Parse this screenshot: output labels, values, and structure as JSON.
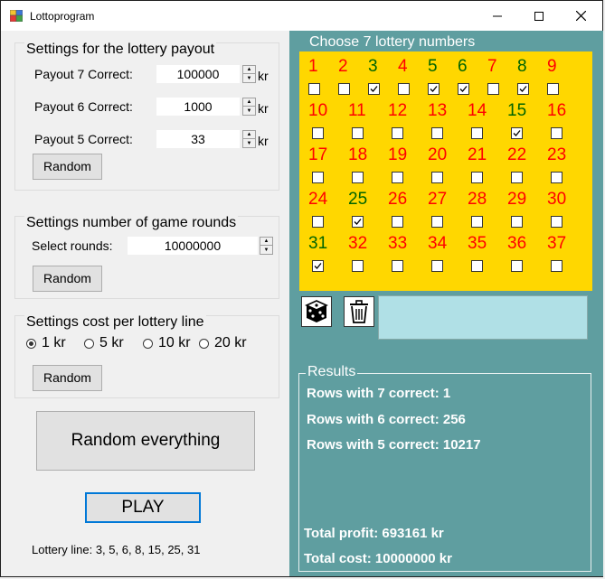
{
  "window": {
    "title": "Lottoprogram"
  },
  "payout": {
    "title": "Settings for the lottery payout",
    "rows": [
      {
        "label": "Payout 7 Correct:",
        "value": "100000",
        "unit": "kr"
      },
      {
        "label": "Payout 6 Correct:",
        "value": "1000",
        "unit": "kr"
      },
      {
        "label": "Payout 5 Correct:",
        "value": "33",
        "unit": "kr"
      }
    ],
    "random_label": "Random"
  },
  "rounds": {
    "title": "Settings number of game rounds",
    "label": "Select rounds:",
    "value": "10000000",
    "random_label": "Random"
  },
  "cost": {
    "title": "Settings cost per lottery line",
    "options": [
      "1 kr",
      "5 kr",
      "10 kr",
      "20 kr"
    ],
    "selected": "1 kr",
    "random_label": "Random"
  },
  "actions": {
    "random_everything": "Random everything",
    "play": "PLAY"
  },
  "lottery_line": "Lottery line: 3, 5, 6, 8, 15, 25, 31",
  "choose": {
    "title": "Choose 7 lottery numbers",
    "numbers": [
      {
        "n": "1",
        "checked": false
      },
      {
        "n": "2",
        "checked": false
      },
      {
        "n": "3",
        "checked": true
      },
      {
        "n": "4",
        "checked": false
      },
      {
        "n": "5",
        "checked": true
      },
      {
        "n": "6",
        "checked": true
      },
      {
        "n": "7",
        "checked": false
      },
      {
        "n": "8",
        "checked": true
      },
      {
        "n": "9",
        "checked": false
      },
      {
        "n": "10",
        "checked": false
      },
      {
        "n": "11",
        "checked": false
      },
      {
        "n": "12",
        "checked": false
      },
      {
        "n": "13",
        "checked": false
      },
      {
        "n": "14",
        "checked": false
      },
      {
        "n": "15",
        "checked": true
      },
      {
        "n": "16",
        "checked": false
      },
      {
        "n": "17",
        "checked": false
      },
      {
        "n": "18",
        "checked": false
      },
      {
        "n": "19",
        "checked": false
      },
      {
        "n": "20",
        "checked": false
      },
      {
        "n": "21",
        "checked": false
      },
      {
        "n": "22",
        "checked": false
      },
      {
        "n": "23",
        "checked": false
      },
      {
        "n": "24",
        "checked": false
      },
      {
        "n": "25",
        "checked": true
      },
      {
        "n": "26",
        "checked": false
      },
      {
        "n": "27",
        "checked": false
      },
      {
        "n": "28",
        "checked": false
      },
      {
        "n": "29",
        "checked": false
      },
      {
        "n": "30",
        "checked": false
      },
      {
        "n": "31",
        "checked": true
      },
      {
        "n": "32",
        "checked": false
      },
      {
        "n": "33",
        "checked": false
      },
      {
        "n": "34",
        "checked": false
      },
      {
        "n": "35",
        "checked": false
      },
      {
        "n": "36",
        "checked": false
      },
      {
        "n": "37",
        "checked": false
      }
    ],
    "colors": {
      "unchecked": "#ff0000",
      "checked": "#006400",
      "background": "#ffd700"
    }
  },
  "tools": {
    "dice_icon": "dice-icon",
    "trash_icon": "trash-icon",
    "display_text": ""
  },
  "results": {
    "title": "Results",
    "lines": [
      "Rows with 7 correct: 1",
      "Rows with 6 correct: 256",
      "Rows with 5 correct: 10217"
    ],
    "profit": "Total profit: 693161 kr",
    "cost": "Total cost: 10000000 kr"
  },
  "colors": {
    "panel": "#5f9ea0",
    "display": "#b0e0e6",
    "play_border": "#0078d7"
  }
}
